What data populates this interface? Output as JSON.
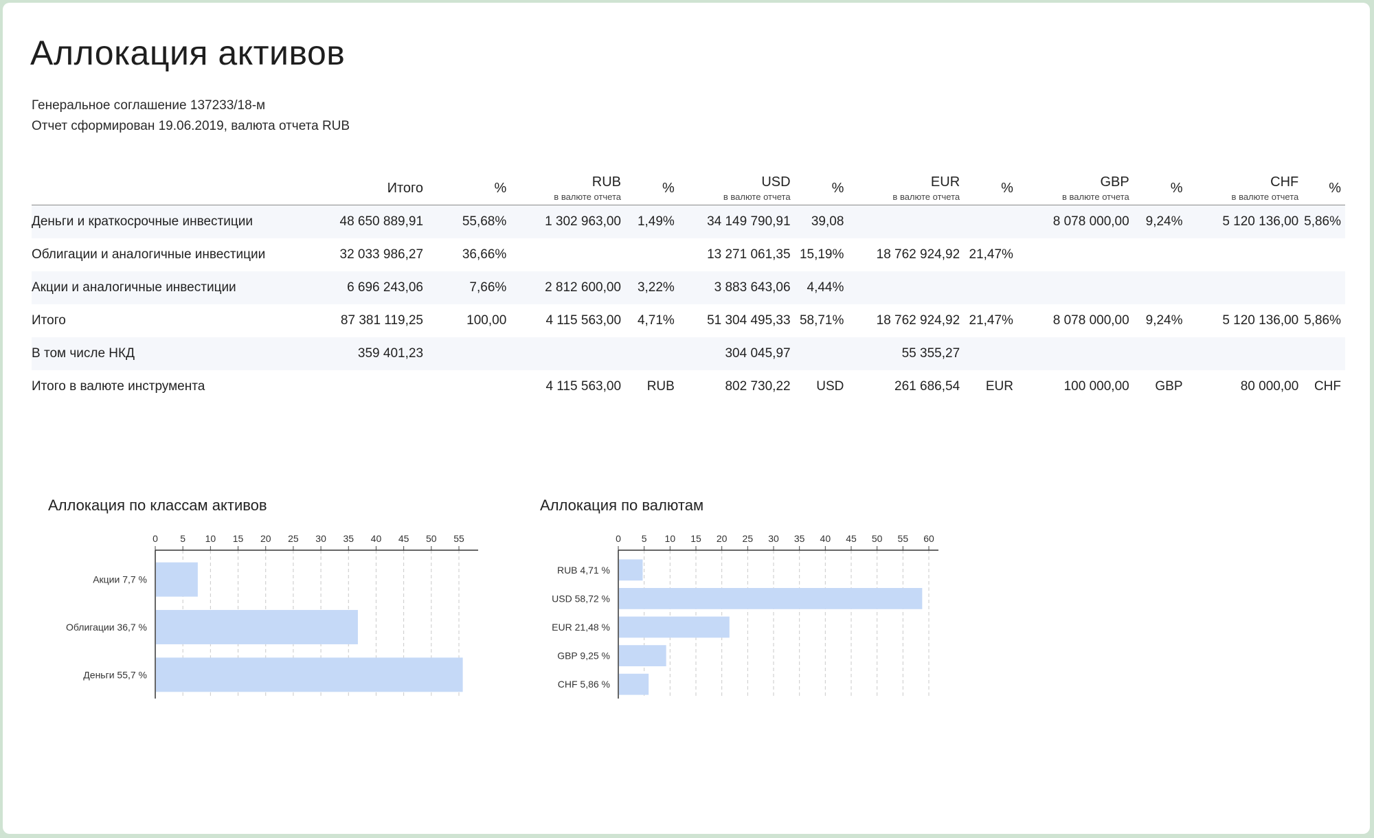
{
  "report": {
    "title": "Аллокация активов",
    "agreement": "Генеральное соглашение 137233/18-м",
    "generated": "Отчет сформирован 19.06.2019, валюта отчета RUB"
  },
  "table": {
    "headers": [
      {
        "label": "",
        "sub": ""
      },
      {
        "label": "Итого",
        "sub": ""
      },
      {
        "label": "%",
        "sub": ""
      },
      {
        "label": "RUB",
        "sub": "в валюте отчета"
      },
      {
        "label": "%",
        "sub": ""
      },
      {
        "label": "USD",
        "sub": "в валюте отчета"
      },
      {
        "label": "%",
        "sub": ""
      },
      {
        "label": "EUR",
        "sub": "в валюте отчета"
      },
      {
        "label": "%",
        "sub": ""
      },
      {
        "label": "GBP",
        "sub": "в валюте отчета"
      },
      {
        "label": "%",
        "sub": ""
      },
      {
        "label": "CHF",
        "sub": "в валюте отчета"
      },
      {
        "label": "%",
        "sub": ""
      }
    ],
    "rows": [
      [
        "Деньги и краткосрочные инвестиции",
        "48 650 889,91",
        "55,68%",
        "1 302 963,00",
        "1,49%",
        "34 149 790,91",
        "39,08",
        "",
        "",
        "8 078 000,00",
        "9,24%",
        "5 120 136,00",
        "5,86%"
      ],
      [
        "Облигации и аналогичные  инвестиции",
        "32 033 986,27",
        "36,66%",
        "",
        "",
        "13 271 061,35",
        "15,19%",
        "18 762 924,92",
        "21,47%",
        "",
        "",
        "",
        ""
      ],
      [
        "Акции и аналогичные инвестиции",
        "6 696 243,06",
        "7,66%",
        "2 812 600,00",
        "3,22%",
        "3 883 643,06",
        "4,44%",
        "",
        "",
        "",
        "",
        "",
        ""
      ],
      [
        "Итого",
        "87 381 119,25",
        "100,00",
        "4 115 563,00",
        "4,71%",
        "51 304 495,33",
        "58,71%",
        "18 762 924,92",
        "21,47%",
        "8 078 000,00",
        "9,24%",
        "5 120 136,00",
        "5,86%"
      ],
      [
        "В том числе НКД",
        "359 401,23",
        "",
        "",
        "",
        "304 045,97",
        "",
        "55 355,27",
        "",
        "",
        "",
        "",
        ""
      ],
      [
        "Итого в валюте инструмента",
        "",
        "",
        "4 115 563,00",
        "RUB",
        "802 730,22",
        "USD",
        "261 686,54",
        "EUR",
        "100 000,00",
        "GBP",
        "80 000,00",
        "CHF"
      ]
    ]
  },
  "chart_data": [
    {
      "type": "bar",
      "orientation": "horizontal",
      "title": "Аллокация по классам активов",
      "categories": [
        "Акции 7,7 %",
        "Облигации 36,7 %",
        "Деньги 55,7 %"
      ],
      "values": [
        7.7,
        36.7,
        55.7
      ],
      "xlim": [
        0,
        55
      ],
      "xticks": [
        0,
        5,
        10,
        15,
        20,
        25,
        30,
        35,
        40,
        45,
        50,
        55
      ],
      "grid": "vertical dashed",
      "axis_position": "top",
      "bar_color": "#c5d9f7"
    },
    {
      "type": "bar",
      "orientation": "horizontal",
      "title": "Аллокация по валютам",
      "categories": [
        "RUB 4,71 %",
        "USD 58,72 %",
        "EUR 21,48 %",
        "GBP 9,25 %",
        "CHF 5,86 %"
      ],
      "values": [
        4.71,
        58.72,
        21.48,
        9.25,
        5.86
      ],
      "xlim": [
        0,
        60
      ],
      "xticks": [
        0,
        5,
        10,
        15,
        20,
        25,
        30,
        35,
        40,
        45,
        50,
        55,
        60
      ],
      "grid": "vertical dashed",
      "axis_position": "top",
      "bar_color": "#c5d9f7"
    }
  ]
}
